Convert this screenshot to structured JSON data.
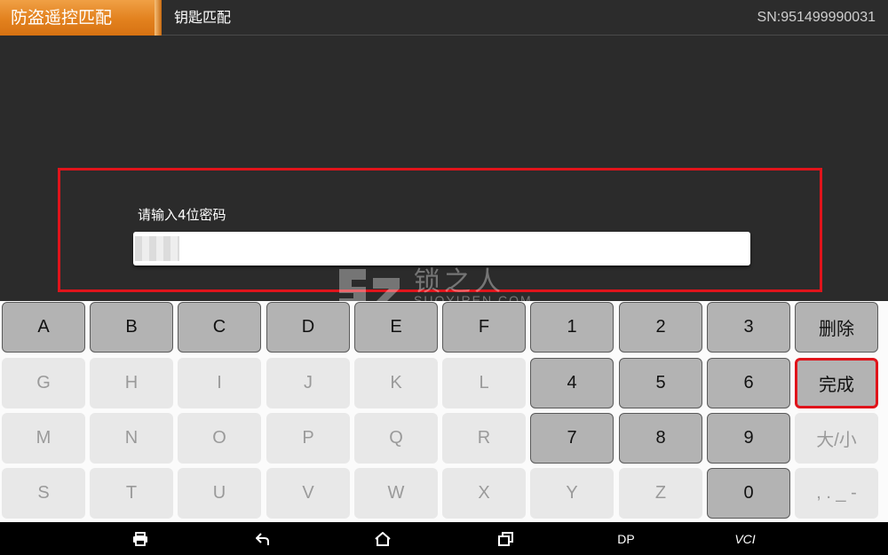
{
  "header": {
    "title": "防盗遥控匹配",
    "subtitle": "钥匙匹配",
    "serial": "SN:951499990031"
  },
  "dialog": {
    "prompt": "请输入4位密码",
    "value": ""
  },
  "watermark": {
    "text": "锁之人",
    "sub": "SUOYIREN.COM"
  },
  "keyboard": {
    "keys": [
      {
        "label": "A",
        "active": true
      },
      {
        "label": "B",
        "active": true
      },
      {
        "label": "C",
        "active": true
      },
      {
        "label": "D",
        "active": true
      },
      {
        "label": "E",
        "active": true
      },
      {
        "label": "F",
        "active": true
      },
      {
        "label": "1",
        "active": true
      },
      {
        "label": "2",
        "active": true
      },
      {
        "label": "3",
        "active": true
      },
      {
        "label": "删除",
        "active": true
      },
      {
        "label": "G",
        "active": false
      },
      {
        "label": "H",
        "active": false
      },
      {
        "label": "I",
        "active": false
      },
      {
        "label": "J",
        "active": false
      },
      {
        "label": "K",
        "active": false
      },
      {
        "label": "L",
        "active": false
      },
      {
        "label": "4",
        "active": true
      },
      {
        "label": "5",
        "active": true
      },
      {
        "label": "6",
        "active": true
      },
      {
        "label": "完成",
        "active": true,
        "highlight": true
      },
      {
        "label": "M",
        "active": false
      },
      {
        "label": "N",
        "active": false
      },
      {
        "label": "O",
        "active": false
      },
      {
        "label": "P",
        "active": false
      },
      {
        "label": "Q",
        "active": false
      },
      {
        "label": "R",
        "active": false
      },
      {
        "label": "7",
        "active": true
      },
      {
        "label": "8",
        "active": true
      },
      {
        "label": "9",
        "active": true
      },
      {
        "label": "大/小",
        "active": false
      },
      {
        "label": "S",
        "active": false
      },
      {
        "label": "T",
        "active": false
      },
      {
        "label": "U",
        "active": false
      },
      {
        "label": "V",
        "active": false
      },
      {
        "label": "W",
        "active": false
      },
      {
        "label": "X",
        "active": false
      },
      {
        "label": "Y",
        "active": false
      },
      {
        "label": "Z",
        "active": false
      },
      {
        "label": "0",
        "active": true
      },
      {
        "label": ", . _ -",
        "active": false
      }
    ]
  },
  "navbar": {
    "dp_label": "DP",
    "vci_label": "VCI"
  },
  "colors": {
    "accent": "#e2811e",
    "highlight_border": "#e0141b"
  }
}
